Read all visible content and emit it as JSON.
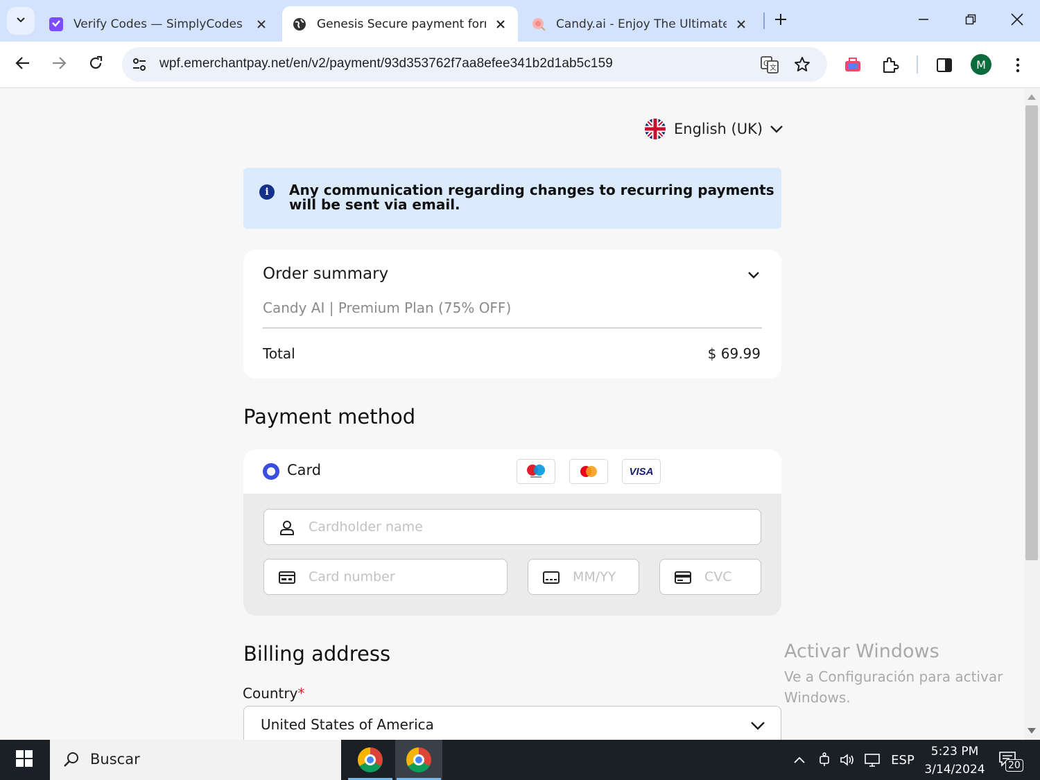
{
  "browser": {
    "tabs": [
      {
        "title": "Verify Codes — SimplyCodes",
        "active": false
      },
      {
        "title": "Genesis Secure payment form",
        "active": true
      },
      {
        "title": "Candy.ai - Enjoy The Ultimate A",
        "active": false
      }
    ],
    "url": "wpf.emerchantpay.net/en/v2/payment/93d353762f7aa8efee341b2d1ab5c159",
    "profile_initial": "M"
  },
  "page": {
    "language": "English (UK)",
    "notice": "Any communication regarding changes to recurring payments will be sent via email.",
    "order_summary": {
      "title": "Order summary",
      "item": "Candy AI | Premium Plan (75% OFF)",
      "total_label": "Total",
      "total_value": "$ 69.99"
    },
    "payment_method": {
      "title": "Payment method",
      "option_label": "Card",
      "brands": [
        "maestro",
        "mastercard",
        "VISA"
      ],
      "cardholder_placeholder": "Cardholder name",
      "card_number_placeholder": "Card number",
      "expiry_placeholder": "MM/YY",
      "cvc_placeholder": "CVC"
    },
    "billing": {
      "title": "Billing address",
      "country_label": "Country",
      "required_mark": "*",
      "country_value": "United States of America"
    }
  },
  "watermark": {
    "title": "Activar Windows",
    "subtitle": "Ve a Configuración para activar Windows."
  },
  "taskbar": {
    "search_text": "Buscar",
    "language": "ESP",
    "time": "5:23 PM",
    "date": "3/14/2024",
    "notification_count": "20"
  },
  "colors": {
    "tabstrip": "#d3e3fd",
    "accent_radio": "#3b4ee0",
    "notice_bg": "#dbeafc",
    "required": "#e02424"
  }
}
